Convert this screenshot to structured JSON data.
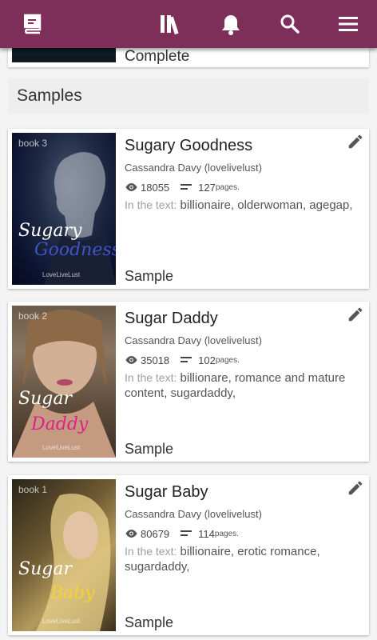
{
  "topbar": {
    "background": "#7d2f5a",
    "icons": [
      "book-logo-icon",
      "library-icon",
      "bell-icon",
      "search-icon",
      "menu-icon"
    ]
  },
  "partial_card": {
    "status": "Complete"
  },
  "section": {
    "title": "Samples"
  },
  "labels": {
    "in_text": "In the text:",
    "pages_suffix": "pages.",
    "sample": "Sample"
  },
  "books": [
    {
      "title": "Sugary Goodness",
      "author": "Cassandra Davy (lovelivelust)",
      "views": "18055",
      "pages": "127",
      "tags": "billionaire, olderwoman, agegap,",
      "cover": {
        "book_num": "book 3",
        "line1": "Sugary",
        "line2": "Goodness",
        "mark": "LoveLiveLust"
      }
    },
    {
      "title": "Sugar Daddy",
      "author": "Cassandra Davy (lovelivelust)",
      "views": "35018",
      "pages": "102",
      "tags": "billionare, romance and mature content, sugardaddy,",
      "cover": {
        "book_num": "book 2",
        "line1": "Sugar",
        "line2": "Daddy",
        "mark": "LoveLiveLust"
      }
    },
    {
      "title": "Sugar Baby",
      "author": "Cassandra Davy (lovelivelust)",
      "views": "80679",
      "pages": "114",
      "tags": "billionaire, erotic romance, sugardaddy,",
      "cover": {
        "book_num": "book 1",
        "line1": "Sugar",
        "line2": "Baby",
        "mark": "LoveLiveLust"
      }
    }
  ]
}
